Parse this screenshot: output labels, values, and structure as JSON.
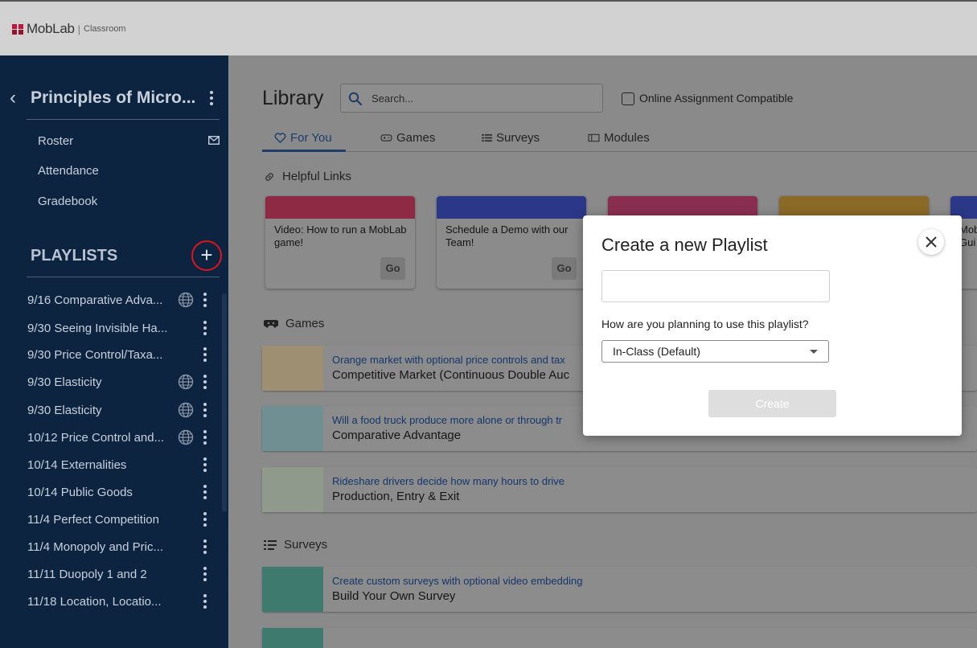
{
  "app": {
    "logo_name": "MobLab",
    "logo_sub": "Classroom"
  },
  "sidebar": {
    "course_title": "Principles of Micro...",
    "nav": [
      {
        "label": "Roster"
      },
      {
        "label": "Attendance"
      },
      {
        "label": "Gradebook"
      }
    ],
    "playlists_header": "PLAYLISTS",
    "add_label": "+",
    "playlists": [
      {
        "label": "9/16 Comparative Adva...",
        "shared": true
      },
      {
        "label": "9/30 Seeing Invisible Ha...",
        "shared": false
      },
      {
        "label": "9/30 Price Control/Taxa...",
        "shared": false
      },
      {
        "label": "9/30 Elasticity",
        "shared": true
      },
      {
        "label": "9/30 Elasticity",
        "shared": true
      },
      {
        "label": "10/12 Price Control and...",
        "shared": true
      },
      {
        "label": "10/14 Externalities",
        "shared": false
      },
      {
        "label": "10/14 Public Goods",
        "shared": false
      },
      {
        "label": "11/4 Perfect Competition",
        "shared": false
      },
      {
        "label": "11/4 Monopoly and Pric...",
        "shared": false
      },
      {
        "label": "11/11 Duopoly 1 and 2",
        "shared": false
      },
      {
        "label": "11/18 Location, Locatio...",
        "shared": false
      }
    ]
  },
  "library": {
    "title": "Library",
    "search_placeholder": "Search...",
    "online_compatible_label": "Online Assignment Compatible",
    "tabs": [
      {
        "label": "For You"
      },
      {
        "label": "Games"
      },
      {
        "label": "Surveys"
      },
      {
        "label": "Modules"
      }
    ],
    "helpful_links_header": "Helpful Links",
    "helpful_links": [
      {
        "text": "Video: How to run a MobLab game!",
        "button": "Go",
        "color": "#8f2a44"
      },
      {
        "text": "Schedule a Demo with our Team!",
        "button": "Go",
        "color": "#2b3887"
      },
      {
        "text": "",
        "button": "",
        "color": "#8a2e50"
      },
      {
        "text": "",
        "button": "",
        "color": "#8b6a28"
      },
      {
        "text": "Mob Gui",
        "button": "",
        "color": "#2b3887"
      }
    ],
    "games_header": "Games",
    "games": [
      {
        "subtitle": "Orange market with optional price controls and tax",
        "title": "Competitive Market (Continuous Double Auc"
      },
      {
        "subtitle": "Will a food truck produce more alone or through tr",
        "title": "Comparative Advantage"
      },
      {
        "subtitle": "Rideshare drivers decide how many hours to drive",
        "title": "Production, Entry & Exit"
      }
    ],
    "surveys_header": "Surveys",
    "surveys": [
      {
        "subtitle": "Create custom surveys with optional video embedding",
        "title": "Build Your Own Survey"
      }
    ]
  },
  "modal": {
    "title": "Create a new Playlist",
    "name_value": "",
    "usage_question": "How are you planning to use this playlist?",
    "usage_selected": "In-Class (Default)",
    "create_label": "Create"
  },
  "colors": {
    "sidebar_bg": "#0d2440",
    "accent": "#1f3d66",
    "highlight_circle": "#e0141a"
  }
}
